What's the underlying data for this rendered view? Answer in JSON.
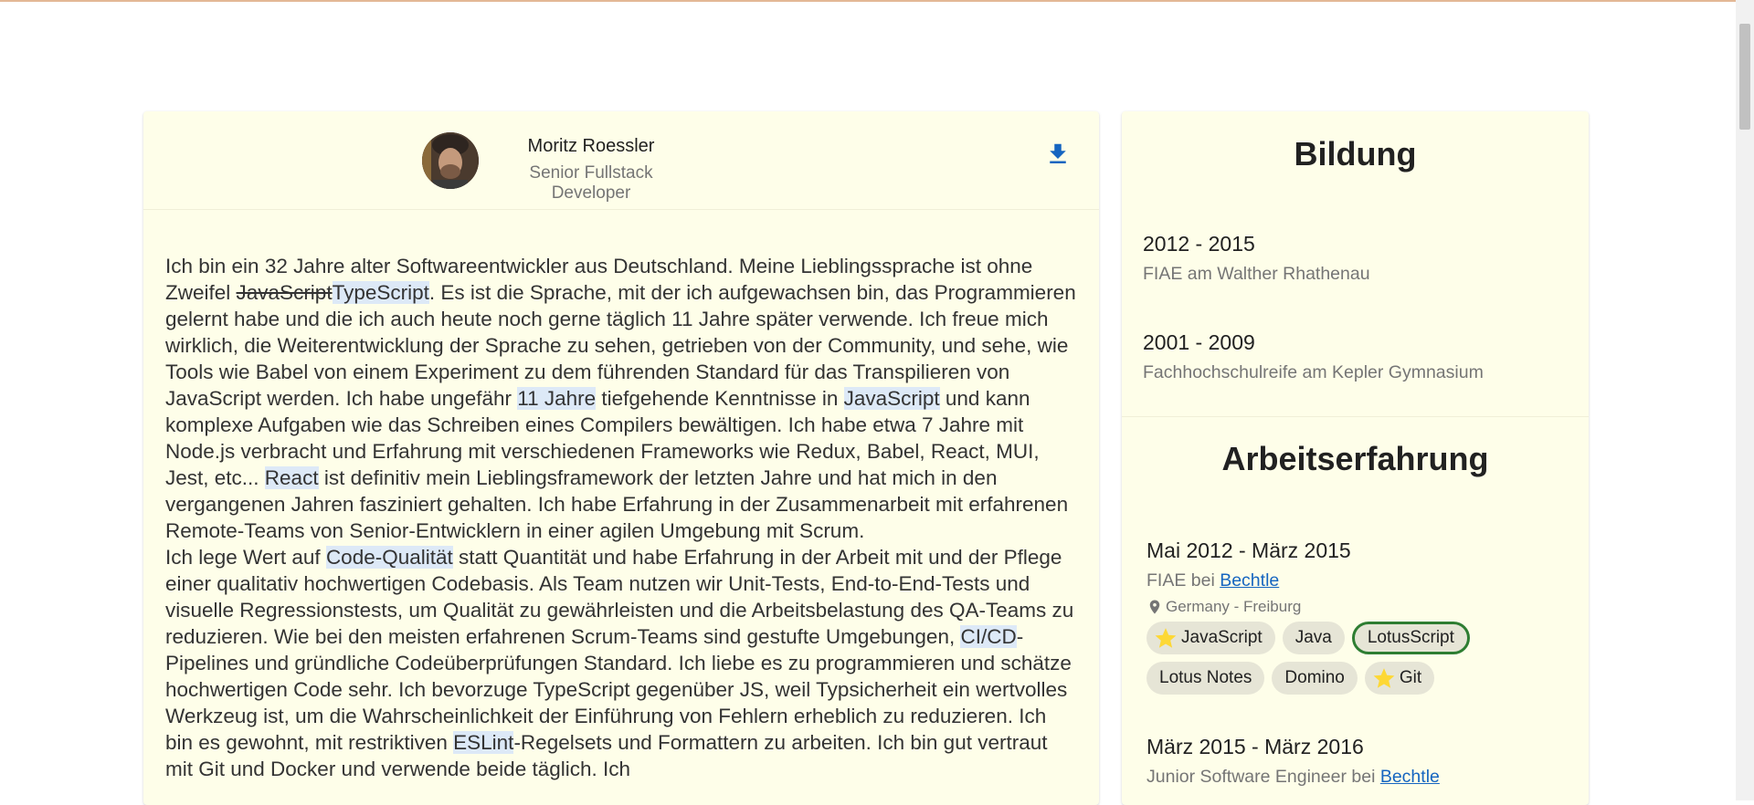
{
  "profile": {
    "name": "Moritz Roessler",
    "title": "Senior Fullstack Developer"
  },
  "bio": {
    "p1_a": "Ich bin ein 32 Jahre alter Softwareentwickler aus Deutschland. Meine Lieblingssprache ist ohne Zweifel ",
    "p1_strike": "JavaScript",
    "p1_hl1": "TypeScript",
    "p1_b": ". Es ist die Sprache, mit der ich aufgewachsen bin, das Programmieren gelernt habe und die ich auch heute noch gerne täglich 11 Jahre später verwende. Ich freue mich wirklich, die Weiterentwicklung der Sprache zu sehen, getrieben von der Community, und sehe, wie Tools wie Babel von einem Experiment zu dem führenden Standard für das Transpilieren von JavaScript werden. Ich habe ungefähr ",
    "p1_hl2": "11 Jahre",
    "p1_c": " tiefgehende Kenntnisse in ",
    "p1_hl3": "JavaScript",
    "p1_d": " und kann komplexe Aufgaben wie das Schreiben eines Compilers bewältigen. Ich habe etwa 7 Jahre mit Node.js verbracht und Erfahrung mit verschiedenen Frameworks wie Redux, Babel, React, MUI, Jest, etc... ",
    "p1_hl4": "React",
    "p1_e": " ist definitiv mein Lieblingsframework der letzten Jahre und hat mich in den vergangenen Jahren fasziniert gehalten. Ich habe Erfahrung in der Zusammenarbeit mit erfahrenen Remote-Teams von Senior-Entwicklern in einer agilen Umgebung mit Scrum.",
    "p2_a": "Ich lege Wert auf ",
    "p2_hl1": "Code-Qualität",
    "p2_b": " statt Quantität und habe Erfahrung in der Arbeit mit und der Pflege einer qualitativ hochwertigen Codebasis. Als Team nutzen wir Unit-Tests, End-to-End-Tests und visuelle Regressionstests, um Qualität zu gewährleisten und die Arbeitsbelastung des QA-Teams zu reduzieren. Wie bei den meisten erfahrenen Scrum-Teams sind gestufte Umgebungen, ",
    "p2_hl2": "CI/CD",
    "p2_c": "-Pipelines und gründliche Codeüberprüfungen Standard. Ich liebe es zu programmieren und schätze hochwertigen Code sehr. Ich bevorzuge TypeScript gegenüber JS, weil Typsicherheit ein wertvolles Werkzeug ist, um die Wahrscheinlichkeit der Einführung von Fehlern erheblich zu reduzieren. Ich bin es gewohnt, mit restriktiven ",
    "p2_hl3": "ESLint",
    "p2_d": "-Regelsets und Formattern zu arbeiten. Ich bin gut vertraut mit Git und Docker und verwende beide täglich. Ich"
  },
  "education": {
    "heading": "Bildung",
    "items": [
      {
        "period": "2012 - 2015",
        "desc": "FIAE am Walther Rhathenau"
      },
      {
        "period": "2001 - 2009",
        "desc": "Fachhochschulreife am Kepler Gymnasium"
      }
    ]
  },
  "work": {
    "heading": "Arbeitserfahrung",
    "jobs": [
      {
        "period": "Mai 2012 - März 2015",
        "role": "FIAE bei ",
        "company": "Bechtle",
        "location": "Germany - Freiburg",
        "skills": [
          "JavaScript",
          "Java",
          "LotusScript",
          "Lotus Notes",
          "Domino",
          "Git"
        ]
      },
      {
        "period": "März 2015 - März 2016",
        "role": "Junior Software Engineer bei ",
        "company": "Bechtle"
      }
    ]
  },
  "colors": {
    "card": "#fefee9",
    "highlight": "#dde9f7",
    "link": "#1565c0",
    "accent_outline": "#2e7d32",
    "star": "#fdd835"
  },
  "icons": [
    "download-icon",
    "location-pin-icon",
    "star-icon"
  ]
}
